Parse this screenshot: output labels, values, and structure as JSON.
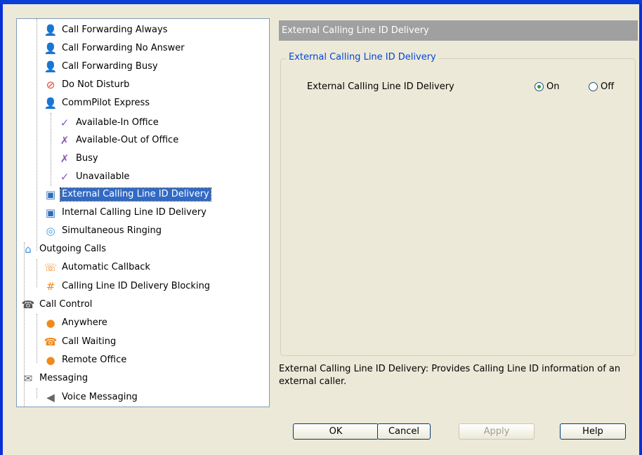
{
  "tree": {
    "items": [
      {
        "label": "Call Forwarding Always",
        "icon": "call-forwarding-always-icon"
      },
      {
        "label": "Call Forwarding No Answer",
        "icon": "call-forwarding-no-answer-icon"
      },
      {
        "label": "Call Forwarding Busy",
        "icon": "call-forwarding-busy-icon"
      },
      {
        "label": "Do Not Disturb",
        "icon": "do-not-disturb-icon"
      },
      {
        "label": "CommPilot Express",
        "icon": "commpilot-express-icon"
      },
      {
        "label": "Available-In Office",
        "icon": "available-in-office-icon"
      },
      {
        "label": "Available-Out of Office",
        "icon": "available-out-of-office-icon"
      },
      {
        "label": "Busy",
        "icon": "busy-icon"
      },
      {
        "label": "Unavailable",
        "icon": "unavailable-icon"
      },
      {
        "label": "External Calling Line ID Delivery",
        "icon": "external-clid-icon",
        "selected": true
      },
      {
        "label": "Internal Calling Line ID Delivery",
        "icon": "internal-clid-icon"
      },
      {
        "label": "Simultaneous Ringing",
        "icon": "simultaneous-ringing-icon"
      },
      {
        "label": "Outgoing Calls",
        "icon": "outgoing-calls-icon"
      },
      {
        "label": "Automatic Callback",
        "icon": "automatic-callback-icon"
      },
      {
        "label": "Calling Line ID Delivery Blocking",
        "icon": "clid-blocking-icon"
      },
      {
        "label": "Call Control",
        "icon": "call-control-icon"
      },
      {
        "label": "Anywhere",
        "icon": "anywhere-icon"
      },
      {
        "label": "Call Waiting",
        "icon": "call-waiting-icon"
      },
      {
        "label": "Remote Office",
        "icon": "remote-office-icon"
      },
      {
        "label": "Messaging",
        "icon": "messaging-icon"
      },
      {
        "label": "Voice Messaging",
        "icon": "voice-messaging-icon"
      }
    ],
    "scroll_up_icon": "scroll-up-icon",
    "scroll_down_icon": "scroll-down-icon"
  },
  "panel": {
    "title": "External Calling Line ID Delivery",
    "group_title": "External Calling Line ID Delivery",
    "option_label": "External Calling Line ID Delivery",
    "radio_on": "On",
    "radio_off": "Off",
    "selected": "On",
    "description": "External Calling Line ID Delivery: Provides Calling Line ID information of an external caller."
  },
  "buttons": {
    "ok": "OK",
    "cancel": "Cancel",
    "apply": "Apply",
    "help": "Help"
  },
  "colors": {
    "selection": "#316ac5",
    "title_bg": "#a0a0a0",
    "group_title": "#0046d5",
    "window_frame": "#0a3fd6"
  }
}
